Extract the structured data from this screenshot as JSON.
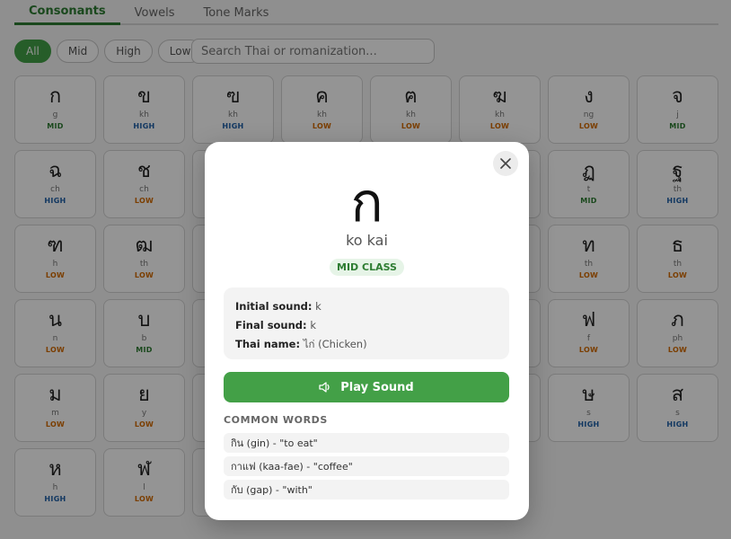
{
  "tabs": [
    {
      "label": "Consonants",
      "active": true
    },
    {
      "label": "Vowels",
      "active": false
    },
    {
      "label": "Tone Marks",
      "active": false
    }
  ],
  "filters": [
    {
      "label": "All",
      "active": true
    },
    {
      "label": "Mid",
      "active": false
    },
    {
      "label": "High",
      "active": false
    },
    {
      "label": "Low",
      "active": false
    }
  ],
  "search": {
    "placeholder": "Search Thai or romanization..."
  },
  "cards": [
    {
      "char": "ก",
      "rom": "g",
      "cls": "MID"
    },
    {
      "char": "ข",
      "rom": "kh",
      "cls": "HIGH"
    },
    {
      "char": "ฃ",
      "rom": "kh",
      "cls": "HIGH"
    },
    {
      "char": "ค",
      "rom": "kh",
      "cls": "LOW"
    },
    {
      "char": "ฅ",
      "rom": "kh",
      "cls": "LOW"
    },
    {
      "char": "ฆ",
      "rom": "kh",
      "cls": "LOW"
    },
    {
      "char": "ง",
      "rom": "ng",
      "cls": "LOW"
    },
    {
      "char": "จ",
      "rom": "j",
      "cls": "MID"
    },
    {
      "char": "ฉ",
      "rom": "ch",
      "cls": "HIGH"
    },
    {
      "char": "ช",
      "rom": "ch",
      "cls": "LOW"
    },
    {
      "char": "",
      "rom": "",
      "cls": ""
    },
    {
      "char": "",
      "rom": "",
      "cls": ""
    },
    {
      "char": "",
      "rom": "",
      "cls": ""
    },
    {
      "char": "",
      "rom": "",
      "cls": ""
    },
    {
      "char": "ฏ",
      "rom": "t",
      "cls": "MID"
    },
    {
      "char": "ฐ",
      "rom": "th",
      "cls": "HIGH"
    },
    {
      "char": "ฑ",
      "rom": "h",
      "cls": "LOW"
    },
    {
      "char": "ฒ",
      "rom": "th",
      "cls": "LOW"
    },
    {
      "char": "",
      "rom": "",
      "cls": ""
    },
    {
      "char": "",
      "rom": "",
      "cls": ""
    },
    {
      "char": "",
      "rom": "",
      "cls": ""
    },
    {
      "char": "",
      "rom": "",
      "cls": ""
    },
    {
      "char": "ท",
      "rom": "th",
      "cls": "LOW"
    },
    {
      "char": "ธ",
      "rom": "th",
      "cls": "LOW"
    },
    {
      "char": "น",
      "rom": "n",
      "cls": "LOW"
    },
    {
      "char": "บ",
      "rom": "b",
      "cls": "MID"
    },
    {
      "char": "",
      "rom": "",
      "cls": ""
    },
    {
      "char": "",
      "rom": "",
      "cls": ""
    },
    {
      "char": "",
      "rom": "",
      "cls": ""
    },
    {
      "char": "",
      "rom": "",
      "cls": ""
    },
    {
      "char": "ฟ",
      "rom": "f",
      "cls": "LOW"
    },
    {
      "char": "ภ",
      "rom": "ph",
      "cls": "LOW"
    },
    {
      "char": "ม",
      "rom": "m",
      "cls": "LOW"
    },
    {
      "char": "ย",
      "rom": "y",
      "cls": "LOW"
    },
    {
      "char": "",
      "rom": "",
      "cls": ""
    },
    {
      "char": "",
      "rom": "",
      "cls": ""
    },
    {
      "char": "",
      "rom": "",
      "cls": ""
    },
    {
      "char": "",
      "rom": "",
      "cls": ""
    },
    {
      "char": "ษ",
      "rom": "s",
      "cls": "HIGH"
    },
    {
      "char": "ส",
      "rom": "s",
      "cls": "HIGH"
    },
    {
      "char": "ห",
      "rom": "h",
      "cls": "HIGH"
    },
    {
      "char": "ฬ",
      "rom": "l",
      "cls": "LOW"
    },
    {
      "char": "",
      "rom": "",
      "cls": ""
    }
  ],
  "modal": {
    "char": "ก",
    "name": "ko kai",
    "badge": "MID CLASS",
    "initial_label": "Initial sound:",
    "initial_value": "k",
    "final_label": "Final sound:",
    "final_value": "k",
    "thai_label": "Thai name:",
    "thai_value": "ไก่ (Chicken)",
    "play_label": "Play Sound",
    "common_title": "COMMON WORDS",
    "words": [
      "กิน (gin) - \"to eat\"",
      "กาแฟ (kaa-fae) - \"coffee\"",
      "กับ (gap) - \"with\""
    ]
  },
  "colors": {
    "accent": "#43a047",
    "mid": "#2e7d32",
    "high": "#1e5fa8",
    "low": "#d46b00"
  }
}
